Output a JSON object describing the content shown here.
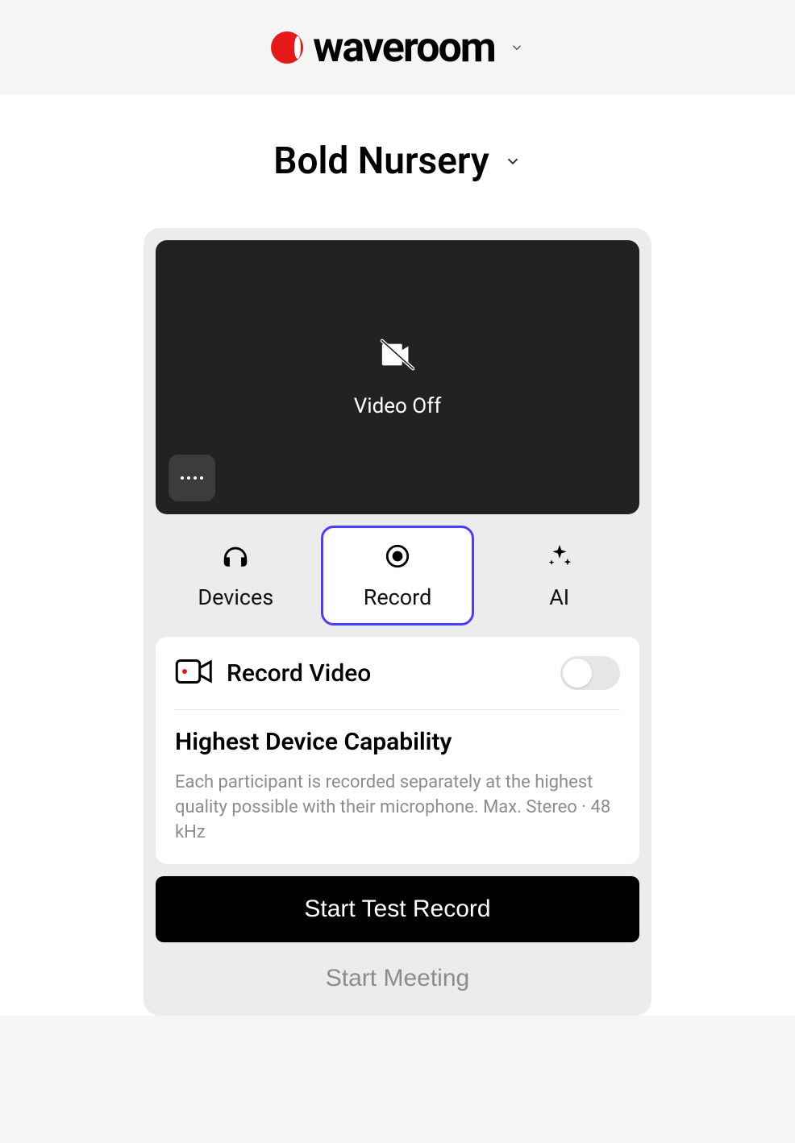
{
  "brand": {
    "name": "waveroom"
  },
  "room": {
    "name": "Bold Nursery"
  },
  "preview": {
    "video_status": "Video Off"
  },
  "tabs": {
    "devices": "Devices",
    "record": "Record",
    "ai": "AI"
  },
  "record_panel": {
    "record_video_label": "Record Video",
    "section_title": "Highest Device Capability",
    "section_desc": "Each participant is recorded separately at the highest quality possible with their microphone. Max. Stereo · 48 kHz"
  },
  "buttons": {
    "start_test_record": "Start Test Record",
    "start_meeting": "Start Meeting"
  }
}
